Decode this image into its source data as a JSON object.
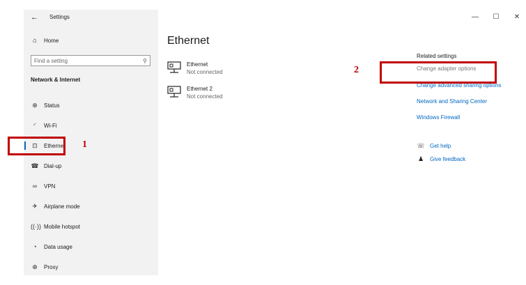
{
  "window": {
    "title": "Settings",
    "back_icon": "arrow-left-icon",
    "controls": [
      "—",
      "☐",
      "✕"
    ]
  },
  "sidebar": {
    "home_label": "Home",
    "search_placeholder": "Find a setting",
    "section_heading": "Network & Internet",
    "items": [
      {
        "label": "Status",
        "icon": "globe-icon"
      },
      {
        "label": "Wi-Fi",
        "icon": "wifi-icon"
      },
      {
        "label": "Ethernet",
        "icon": "ethernet-icon",
        "selected": true
      },
      {
        "label": "Dial-up",
        "icon": "phone-icon"
      },
      {
        "label": "VPN",
        "icon": "vpn-icon"
      },
      {
        "label": "Airplane mode",
        "icon": "airplane-icon"
      },
      {
        "label": "Mobile hotspot",
        "icon": "hotspot-icon"
      },
      {
        "label": "Data usage",
        "icon": "data-usage-icon"
      },
      {
        "label": "Proxy",
        "icon": "globe-icon"
      }
    ]
  },
  "main": {
    "title": "Ethernet",
    "adapters": [
      {
        "name": "Ethernet",
        "status": "Not connected"
      },
      {
        "name": "Ethernet 2",
        "status": "Not connected"
      }
    ],
    "related": {
      "title": "Related settings",
      "links": [
        "Change adapter options",
        "Change advanced sharing options",
        "Network and Sharing Center",
        "Windows Firewall"
      ]
    },
    "help": [
      {
        "label": "Get help",
        "icon": "help-chat-icon"
      },
      {
        "label": "Give feedback",
        "icon": "feedback-icon"
      }
    ]
  },
  "annotations": {
    "label_1": "1",
    "label_2": "2",
    "color": "#c00000"
  },
  "colors": {
    "accent": "#0067c0",
    "sidebar_bg": "#f2f2f2"
  }
}
